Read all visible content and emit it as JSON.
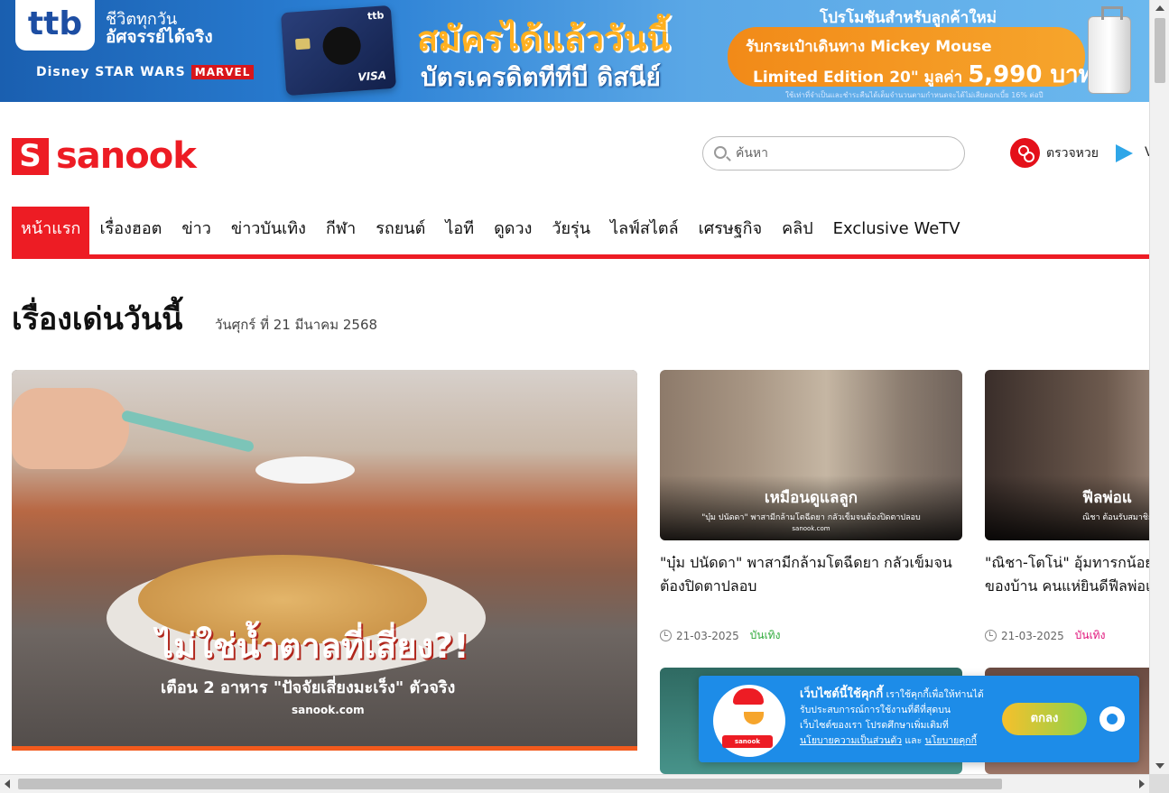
{
  "ad": {
    "logo": "ttb",
    "tagline_1": "ชีวิตทุกวัน",
    "tagline_2": "อัศจรรย์ได้จริง",
    "brands": "Disney  STAR WARS",
    "marvel": "MARVEL",
    "card_brand": "ttb",
    "card_network": "VISA",
    "headline": "สมัครได้แล้ววันนี้",
    "subhead": "บัตรเครดิตทีทีบี ดิสนีย์",
    "promo_title": "โปรโมชันสำหรับลูกค้าใหม่",
    "promo_line1": "รับกระเป๋าเดินทาง Mickey Mouse",
    "promo_line2": "Limited Edition 20\" มูลค่า",
    "promo_price": "5,990 บาท",
    "fine_print": "ใช้เท่าที่จำเป็นและชำระคืนได้เต็มจำนวนตามกำหนดจะได้ไม่เสียดอกเบี้ย 16% ต่อปี"
  },
  "header": {
    "logo_mark": "S",
    "logo_text": "sanook",
    "search_placeholder": "ค้นหา",
    "lotto_label": "ตรวจหวย",
    "play_label": "V"
  },
  "nav": {
    "items": [
      {
        "label": "หน้าแรก",
        "active": true
      },
      {
        "label": "เรื่องฮอต"
      },
      {
        "label": "ข่าว"
      },
      {
        "label": "ข่าวบันเทิง"
      },
      {
        "label": "กีฬา"
      },
      {
        "label": "รถยนต์"
      },
      {
        "label": "ไอที"
      },
      {
        "label": "ดูดวง"
      },
      {
        "label": "วัยรุ่น"
      },
      {
        "label": "ไลฟ์สไตล์"
      },
      {
        "label": "เศรษฐกิจ"
      },
      {
        "label": "คลิป"
      },
      {
        "label": "Exclusive WeTV"
      }
    ]
  },
  "section": {
    "title": "เรื่องเด่นวันนี้",
    "date": "วันศุกร์ ที่ 21 มีนาคม 2568"
  },
  "hero": {
    "title": "ไม่ใช่น้ำตาลที่เสี่ยง?!",
    "subtitle": "เตือน 2 อาหาร \"ปัจจัยเสี่ยงมะเร็ง\" ตัวจริง",
    "brand": "sanook.com"
  },
  "cards": [
    {
      "overlay_big": "เหมือนดูแลลูก",
      "overlay_small": "\"บุ๋ม ปนัดดา\" พาสามีกล้ามโตฉีดยา กลัวเข็มจนต้องปิดตาปลอบ",
      "overlay_brand": "sanook.com",
      "title_1": "\"บุ๋ม ปนัดดา\" พาสามีกล้ามโตฉีดยา กลัวเข็มจน",
      "title_2": "ต้องปิดตาปลอบ",
      "date": "21-03-2025",
      "category": "บันเทิง",
      "category_color": "#2eaa3a"
    },
    {
      "overlay_big": "ฟีลพ่อแ",
      "overlay_small": "ณิชา ต้อนรับสมาชิก",
      "overlay_brand": "",
      "title_1": "\"ณิชา-โตโน่\" อุ้มทารกน้อย",
      "title_2": "ของบ้าน คนแห่ยินดีฟีลพ่อแ",
      "date": "21-03-2025",
      "category": "บันเทิง",
      "category_color": "#e0127a"
    }
  ],
  "cookie": {
    "heading": "เว็บไซต์นี้ใช้คุกกี้",
    "text_1": " เราใช้คุกกี้เพื่อให้ท่านได้",
    "text_2": "รับประสบการณ์การใช้งานที่ดีที่สุดบน",
    "text_3": "เว็บไซต์ของเรา โปรดศึกษาเพิ่มเติมที่",
    "link_privacy": "นโยบายความเป็นส่วนตัว",
    "and": " และ ",
    "link_cookie": "นโยบายคุกกี้",
    "ok_label": "ตกลง",
    "mascot_tag": "sanook"
  }
}
